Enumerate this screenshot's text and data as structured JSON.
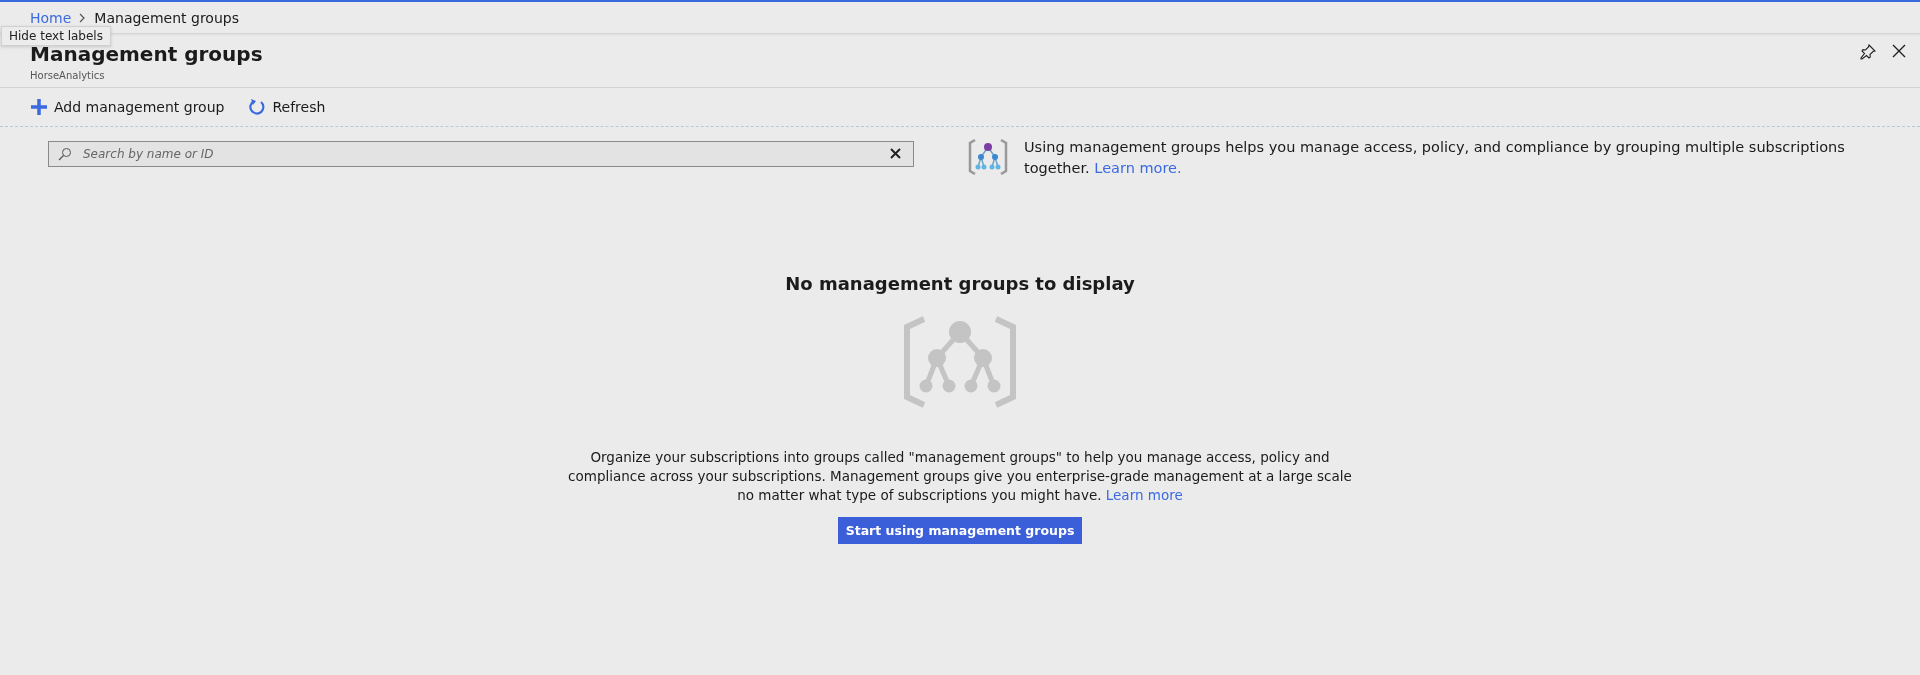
{
  "breadcrumb": [
    {
      "label": "Home",
      "kind": "link"
    },
    {
      "label": "Management groups",
      "kind": "current"
    }
  ],
  "tooltip": "Hide text labels",
  "blade": {
    "title": "Management groups",
    "subtitle": "HorseAnalytics"
  },
  "toolbar": [
    {
      "label": "Add management group",
      "kind": "add"
    },
    {
      "label": "Refresh",
      "kind": "refresh"
    }
  ],
  "search": {
    "placeholder": "Search by name or ID"
  },
  "info": {
    "text": "Using management groups helps you manage access, policy, and compliance by grouping multiple subscriptions together.",
    "link": "Learn more."
  },
  "empty": {
    "title": "No management groups to display",
    "text": "Organize your subscriptions into groups called \"management groups\" to help you manage access, policy and compliance across your subscriptions. Management groups give you enterprise-grade management at a large scale no matter what type of subscriptions you might have.",
    "link": "Learn more",
    "button": "Start using management groups"
  }
}
